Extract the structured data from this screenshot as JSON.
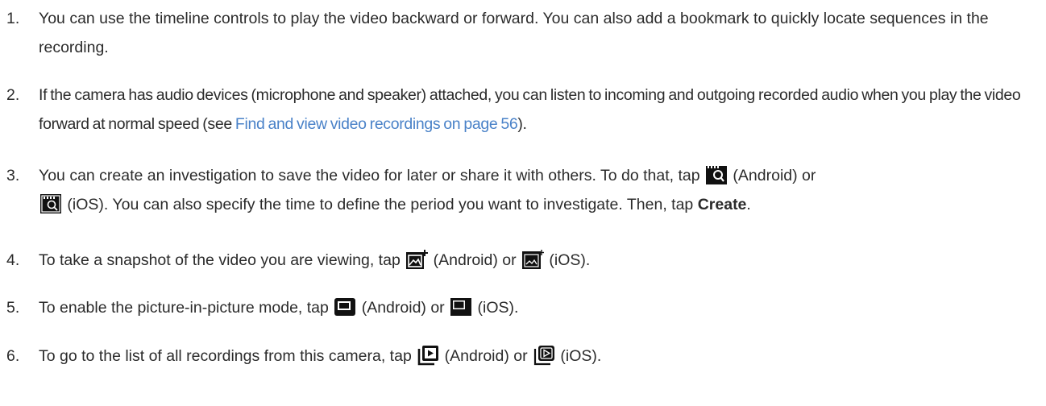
{
  "steps": [
    {
      "number": "1.",
      "text": "You can use the timeline controls to play the video backward or forward. You can also add a bookmark to quickly locate sequences in the recording."
    },
    {
      "number": "2.",
      "text_before": "If the camera has audio devices (microphone and speaker) attached, you can listen to incoming and outgoing recorded audio when you play the video forward at normal speed (see ",
      "link": "Find and view video recordings on page 56",
      "text_after": ")."
    },
    {
      "number": "3.",
      "part1": "You can create an investigation to save the video for later or share it with others. To do that, tap ",
      "part2": " (Android) or",
      "part3": " (iOS). You can also specify the time to define the period you want to investigate. Then, tap ",
      "bold": "Create",
      "part4": ".",
      "icons": [
        "investigation-icon",
        "investigation-icon"
      ]
    },
    {
      "number": "4.",
      "part1": "To take a snapshot of the video you are viewing, tap ",
      "part2": " (Android) or ",
      "part3": " (iOS).",
      "icons": [
        "snapshot-icon",
        "snapshot-icon"
      ]
    },
    {
      "number": "5.",
      "part1": "To enable the picture-in-picture mode, tap ",
      "part2": " (Android) or ",
      "part3": " (iOS).",
      "icons": [
        "picture-in-picture-icon",
        "picture-in-picture-icon"
      ]
    },
    {
      "number": "6.",
      "part1": "To go to the list of all recordings from this camera, tap ",
      "part2": " (Android) or ",
      "part3": " (iOS).",
      "icons": [
        "recordings-list-icon",
        "recordings-list-icon"
      ]
    }
  ]
}
